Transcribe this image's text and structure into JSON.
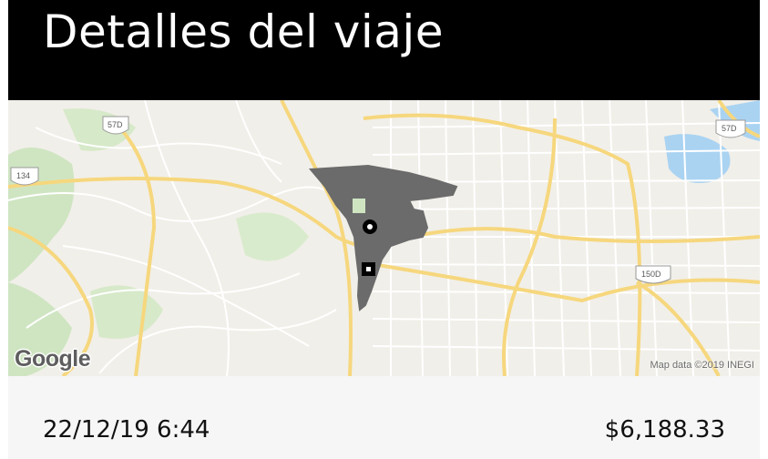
{
  "header": {
    "title": "Detalles del viaje"
  },
  "map": {
    "attribution": "Map data ©2019 INEGI",
    "logo_text": "Google",
    "road_shields": [
      "57D",
      "134",
      "57D",
      "150D"
    ],
    "start_marker_icon": "circle-pin-icon",
    "end_marker_icon": "square-pin-icon"
  },
  "trip": {
    "datetime": "22/12/19 6:44",
    "price": "$6,188.33"
  },
  "colors": {
    "header_bg": "#000000",
    "map_bg": "#f1efe9",
    "route": "#6b6b6b",
    "highway": "#f6d77d"
  }
}
